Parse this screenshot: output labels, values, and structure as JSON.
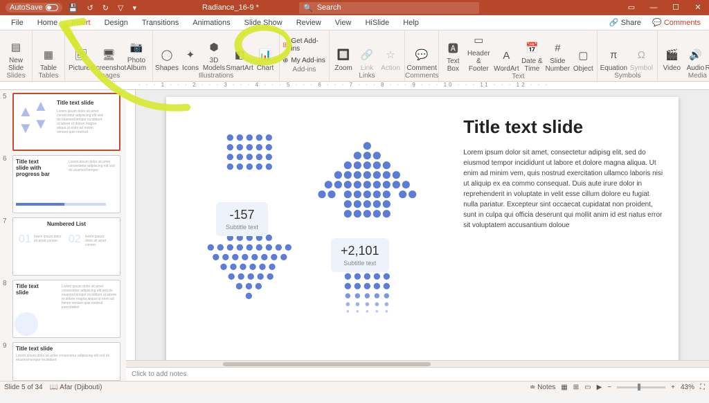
{
  "titlebar": {
    "autosave": "AutoSave",
    "docname": "Radiance_16-9  *",
    "search_placeholder": "Search"
  },
  "menu": {
    "tabs": [
      "File",
      "Home",
      "Insert",
      "Design",
      "Transitions",
      "Animations",
      "Slide Show",
      "Review",
      "View",
      "HiSlide",
      "Help"
    ],
    "share": "Share",
    "comments": "Comments"
  },
  "ribbon": {
    "slides": {
      "newslide": "New\nSlide",
      "label": "Slides"
    },
    "tables": {
      "table": "Table",
      "label": "Tables"
    },
    "images": {
      "pictures": "Pictures",
      "screenshot": "Screenshot",
      "photo": "Photo\nAlbum",
      "label": "Images"
    },
    "illustrations": {
      "shapes": "Shapes",
      "icons": "Icons",
      "models": "3D\nModels",
      "smartart": "SmartArt",
      "chart": "Chart",
      "label": "Illustrations"
    },
    "addins": {
      "get": "Get Add-ins",
      "my": "My Add-ins",
      "label": "Add-ins"
    },
    "links": {
      "zoom": "Zoom",
      "link": "Link",
      "action": "Action",
      "label": "Links"
    },
    "comments": {
      "comment": "Comment",
      "label": "Comments"
    },
    "text": {
      "textbox": "Text\nBox",
      "header": "Header\n& Footer",
      "wordart": "WordArt",
      "date": "Date &\nTime",
      "slidenum": "Slide\nNumber",
      "object": "Object",
      "label": "Text"
    },
    "symbols": {
      "equation": "Equation",
      "symbol": "Symbol",
      "label": "Symbols"
    },
    "media": {
      "video": "Video",
      "audio": "Audio",
      "screen": "Screen\nRecording",
      "label": "Media"
    }
  },
  "thumbs": {
    "t5": {
      "title": "Title text slide"
    },
    "t6": {
      "title": "Title text slide with progress bar"
    },
    "t7": {
      "title": "Numbered List"
    },
    "t8": {
      "title": "Title text slide"
    },
    "t9": {
      "title": "Title text slide"
    }
  },
  "slide": {
    "title": "Title text slide",
    "body": "Lorem ipsum dolor sit amet, consectetur adipisg elit, sed do eiusmod tempor incididunt ut labore et dolore magna aliqua. Ut enim ad minim vem, quis nostrud exercitation ullamco laboris nisi ut aliquip ex ea commo consequat. Duis aute irure dolor in reprehenderit in voluptate in velit esse cillum dolore eu fugiat nulla pariatur. Excepteur sint occaecat cupidatat non proident, sunt in culpa qui officia deserunt qui mollit anim id est natus error sit voluptatem accusantium doloue",
    "val1": "-157",
    "sub1": "Subtitle text",
    "val2": "+2,101",
    "sub2": "Subtitle text"
  },
  "notes": "Click to add notes",
  "status": {
    "pos": "Slide 5 of 34",
    "lang": "Afar (Djibouti)",
    "notes": "Notes",
    "zoom": "43%"
  }
}
